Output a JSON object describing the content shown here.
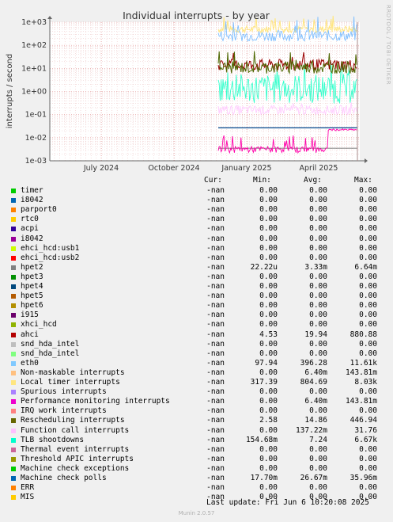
{
  "chart_data": {
    "type": "line",
    "title": "Individual interrupts - by year",
    "ylabel": "interrupts / second",
    "xlabel": "",
    "y_scale": "log",
    "y_ticks": [
      "1e-03",
      "1e-02",
      "1e-01",
      "1e+00",
      "1e+01",
      "1e+02",
      "1e+03"
    ],
    "x_ticks": [
      "July 2024",
      "October 2024",
      "January 2025",
      "April 2025"
    ],
    "series_visible": [
      {
        "name": "eth0",
        "color": "#7fbfff",
        "approx_range": [
          100,
          1000
        ]
      },
      {
        "name": "Local timer interrupts",
        "color": "#ffe680",
        "approx_range": [
          300,
          1000
        ]
      },
      {
        "name": "TLB shootdowns",
        "color": "#33ffcc",
        "approx_range": [
          0.15,
          7
        ]
      },
      {
        "name": "ahci",
        "color": "#990000",
        "approx_range": [
          4.5,
          30
        ]
      },
      {
        "name": "Rescheduling interrupts",
        "color": "#4d6600",
        "approx_range": [
          2.5,
          100
        ]
      },
      {
        "name": "Function call interrupts",
        "color": "#ffccff",
        "approx_range": [
          0.1,
          0.3
        ]
      },
      {
        "name": "Machine check polls",
        "color": "#00468c",
        "approx_range": [
          0.0267,
          0.0267
        ]
      },
      {
        "name": "Non-maskable interrupts",
        "color": "#ff00aa",
        "approx_range": [
          0.002,
          0.02
        ]
      }
    ]
  },
  "legend_header": {
    "cur": "Cur:",
    "min": "Min:",
    "avg": "Avg:",
    "max": "Max:"
  },
  "legend": [
    {
      "name": "timer",
      "color": "#00cc00",
      "cur": "-nan",
      "min": "0.00",
      "avg": "0.00",
      "max": "0.00"
    },
    {
      "name": "i8042",
      "color": "#0066b3",
      "cur": "-nan",
      "min": "0.00",
      "avg": "0.00",
      "max": "0.00"
    },
    {
      "name": "parport0",
      "color": "#ff8000",
      "cur": "-nan",
      "min": "0.00",
      "avg": "0.00",
      "max": "0.00"
    },
    {
      "name": "rtc0",
      "color": "#ffcc00",
      "cur": "-nan",
      "min": "0.00",
      "avg": "0.00",
      "max": "0.00"
    },
    {
      "name": "acpi",
      "color": "#330099",
      "cur": "-nan",
      "min": "0.00",
      "avg": "0.00",
      "max": "0.00"
    },
    {
      "name": "i8042",
      "color": "#990099",
      "cur": "-nan",
      "min": "0.00",
      "avg": "0.00",
      "max": "0.00"
    },
    {
      "name": "ehci_hcd:usb1",
      "color": "#ccff00",
      "cur": "-nan",
      "min": "0.00",
      "avg": "0.00",
      "max": "0.00"
    },
    {
      "name": "ehci_hcd:usb2",
      "color": "#ff0000",
      "cur": "-nan",
      "min": "0.00",
      "avg": "0.00",
      "max": "0.00"
    },
    {
      "name": "hpet2",
      "color": "#808080",
      "cur": "-nan",
      "min": "22.22u",
      "avg": "3.33m",
      "max": "6.64m"
    },
    {
      "name": "hpet3",
      "color": "#008f00",
      "cur": "-nan",
      "min": "0.00",
      "avg": "0.00",
      "max": "0.00"
    },
    {
      "name": "hpet4",
      "color": "#00487d",
      "cur": "-nan",
      "min": "0.00",
      "avg": "0.00",
      "max": "0.00"
    },
    {
      "name": "hpet5",
      "color": "#b35a00",
      "cur": "-nan",
      "min": "0.00",
      "avg": "0.00",
      "max": "0.00"
    },
    {
      "name": "hpet6",
      "color": "#b38f00",
      "cur": "-nan",
      "min": "0.00",
      "avg": "0.00",
      "max": "0.00"
    },
    {
      "name": "i915",
      "color": "#6b006b",
      "cur": "-nan",
      "min": "0.00",
      "avg": "0.00",
      "max": "0.00"
    },
    {
      "name": "xhci_hcd",
      "color": "#8fb300",
      "cur": "-nan",
      "min": "0.00",
      "avg": "0.00",
      "max": "0.00"
    },
    {
      "name": "ahci",
      "color": "#b30000",
      "cur": "-nan",
      "min": "4.53",
      "avg": "19.94",
      "max": "880.88"
    },
    {
      "name": "snd_hda_intel",
      "color": "#bebebe",
      "cur": "-nan",
      "min": "0.00",
      "avg": "0.00",
      "max": "0.00"
    },
    {
      "name": "snd_hda_intel",
      "color": "#80ff80",
      "cur": "-nan",
      "min": "0.00",
      "avg": "0.00",
      "max": "0.00"
    },
    {
      "name": "eth0",
      "color": "#80c9ff",
      "cur": "-nan",
      "min": "97.94",
      "avg": "396.28",
      "max": "11.61k"
    },
    {
      "name": "Non-maskable interrupts",
      "color": "#ffc080",
      "cur": "-nan",
      "min": "0.00",
      "avg": "6.40m",
      "max": "143.81m"
    },
    {
      "name": "Local timer interrupts",
      "color": "#ffe680",
      "cur": "-nan",
      "min": "317.39",
      "avg": "804.69",
      "max": "8.03k"
    },
    {
      "name": "Spurious interrupts",
      "color": "#aa80ff",
      "cur": "-nan",
      "min": "0.00",
      "avg": "0.00",
      "max": "0.00"
    },
    {
      "name": "Performance monitoring interrupts",
      "color": "#ee00cc",
      "cur": "-nan",
      "min": "0.00",
      "avg": "6.40m",
      "max": "143.81m"
    },
    {
      "name": "IRQ work interrupts",
      "color": "#ff8080",
      "cur": "-nan",
      "min": "0.00",
      "avg": "0.00",
      "max": "0.00"
    },
    {
      "name": "Rescheduling interrupts",
      "color": "#666600",
      "cur": "-nan",
      "min": "2.58",
      "avg": "14.86",
      "max": "446.94"
    },
    {
      "name": "Function call interrupts",
      "color": "#ffbfff",
      "cur": "-nan",
      "min": "0.00",
      "avg": "137.22m",
      "max": "31.76"
    },
    {
      "name": "TLB shootdowns",
      "color": "#00ffcc",
      "cur": "-nan",
      "min": "154.68m",
      "avg": "7.24",
      "max": "6.67k"
    },
    {
      "name": "Thermal event interrupts",
      "color": "#cc6699",
      "cur": "-nan",
      "min": "0.00",
      "avg": "0.00",
      "max": "0.00"
    },
    {
      "name": "Threshold APIC interrupts",
      "color": "#999900",
      "cur": "-nan",
      "min": "0.00",
      "avg": "0.00",
      "max": "0.00"
    },
    {
      "name": "Machine check exceptions",
      "color": "#00cc00",
      "cur": "-nan",
      "min": "0.00",
      "avg": "0.00",
      "max": "0.00"
    },
    {
      "name": "Machine check polls",
      "color": "#0066b3",
      "cur": "-nan",
      "min": "17.70m",
      "avg": "26.67m",
      "max": "35.96m"
    },
    {
      "name": "ERR",
      "color": "#ff8000",
      "cur": "-nan",
      "min": "0.00",
      "avg": "0.00",
      "max": "0.00"
    },
    {
      "name": "MIS",
      "color": "#ffcc00",
      "cur": "-nan",
      "min": "0.00",
      "avg": "0.00",
      "max": "0.00"
    }
  ],
  "footer": {
    "last_update": "Last update: Fri Jun  6 10:20:08 2025"
  },
  "munin_version": "Munin 2.0.57",
  "watermark": "RRDTOOL / TOBI OETIKER"
}
